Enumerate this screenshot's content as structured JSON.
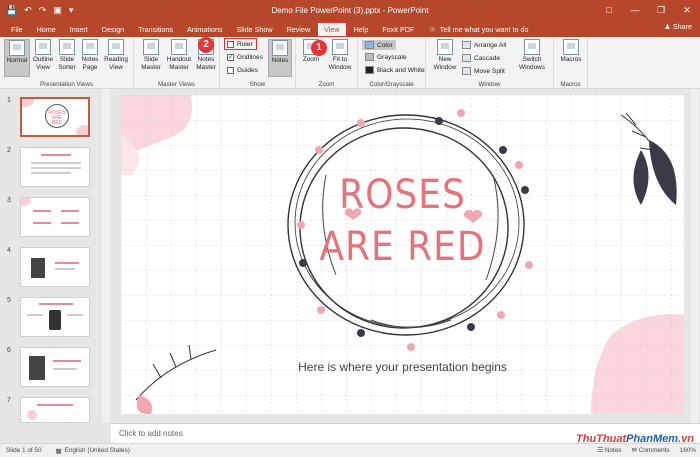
{
  "window": {
    "title": "Demo File PowerPoint (3).pptx",
    "app": "PowerPoint",
    "qat": [
      "save-icon",
      "undo-icon",
      "redo-icon",
      "start-icon",
      "more-icon"
    ]
  },
  "tabs": [
    "File",
    "Home",
    "Insert",
    "Design",
    "Transitions",
    "Animations",
    "Slide Show",
    "Review",
    "View",
    "Help",
    "Foxit PDF"
  ],
  "active_tab": "View",
  "tellme": "Tell me what you want to do",
  "share": "Share",
  "ribbon": {
    "presentation_views": {
      "label": "Presentation Views",
      "buttons": [
        "Normal",
        "Outline View",
        "Slide Sorter",
        "Notes Page",
        "Reading View"
      ]
    },
    "master_views": {
      "label": "Master Views",
      "buttons": [
        "Slide Master",
        "Handout Master",
        "Notes Master"
      ]
    },
    "show": {
      "label": "Show",
      "ruler": "Ruler",
      "gridlines": "Gridlines",
      "guides": "Guides",
      "notes": "Notes",
      "ruler_checked": false,
      "gridlines_checked": true,
      "guides_checked": false
    },
    "zoom": {
      "label": "Zoom",
      "zoom": "Zoom",
      "fit": "Fit to Window"
    },
    "color": {
      "label": "Color/Grayscale",
      "items": [
        "Color",
        "Grayscale",
        "Black and White"
      ]
    },
    "window": {
      "label": "Window",
      "new_window": "New Window",
      "items": [
        "Arrange All",
        "Cascade",
        "Move Split"
      ],
      "switch": "Switch Windows"
    },
    "macros": {
      "label": "Macros",
      "button": "Macros"
    }
  },
  "annotations": {
    "badge1": "1",
    "badge2": "2"
  },
  "thumbnails": [
    "1",
    "2",
    "3",
    "4",
    "5",
    "6",
    "7"
  ],
  "slide": {
    "line1": "ROSES",
    "line2": "ARE RED",
    "subtitle": "Here is where your presentation begins"
  },
  "notes_placeholder": "Click to add notes",
  "status": {
    "slide": "Slide 1 of 50",
    "language": "English (United States)",
    "notes": "Notes",
    "comments": "Comments",
    "zoom": "160%"
  },
  "watermark": {
    "part1": "ThuThuat",
    "part2": "PhanMem",
    "part3": ".vn"
  },
  "colors": {
    "accent": "#b7472a",
    "pink": "#e5747a",
    "annotation": "#e53535"
  }
}
